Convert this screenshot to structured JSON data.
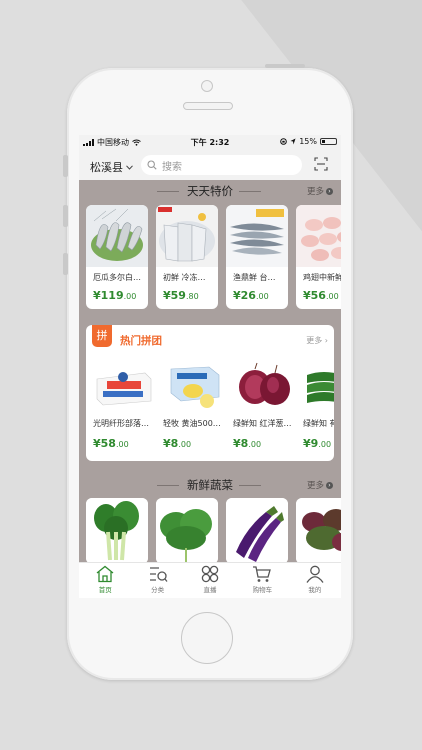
{
  "status": {
    "carrier": "中国移动",
    "time": "下午 2:32",
    "battery": "15%"
  },
  "header": {
    "location": "松溪县",
    "search_placeholder": "搜索"
  },
  "daily_special": {
    "title": "天天特价",
    "more": "更多",
    "items": [
      {
        "name": "厄瓜多尔白…",
        "price": "¥119",
        "cents": ".00"
      },
      {
        "name": "初鲜 冷冻…",
        "price": "¥59",
        "cents": ".80"
      },
      {
        "name": "渔鼎鲜 台…",
        "price": "¥26",
        "cents": ".00"
      },
      {
        "name": "鸡翅中新鲜",
        "price": "¥56",
        "cents": ".00"
      }
    ]
  },
  "group_buy": {
    "badge": "拼",
    "title": "热门拼团",
    "more": "更多",
    "items": [
      {
        "name": "光明纤形部落…",
        "price": "¥58",
        "cents": ".00"
      },
      {
        "name": "轻牧 黄油500…",
        "price": "¥8",
        "cents": ".00"
      },
      {
        "name": "绿鲜知 红洋葱…",
        "price": "¥8",
        "cents": ".00"
      },
      {
        "name": "绿鲜知 有",
        "price": "¥9",
        "cents": ".00"
      }
    ]
  },
  "fresh_veg": {
    "title": "新鲜蔬菜",
    "more": "更多"
  },
  "tabbar": [
    {
      "label": "首页",
      "icon": "home-icon",
      "active": true
    },
    {
      "label": "分类",
      "icon": "category-icon",
      "active": false
    },
    {
      "label": "直播",
      "icon": "live-icon",
      "active": false
    },
    {
      "label": "购物车",
      "icon": "cart-icon",
      "active": false
    },
    {
      "label": "我的",
      "icon": "profile-icon",
      "active": false
    }
  ],
  "colors": {
    "accent": "#2f8a2f",
    "group_orange": "#f06a2e",
    "screen_bg": "#a9a09e"
  }
}
